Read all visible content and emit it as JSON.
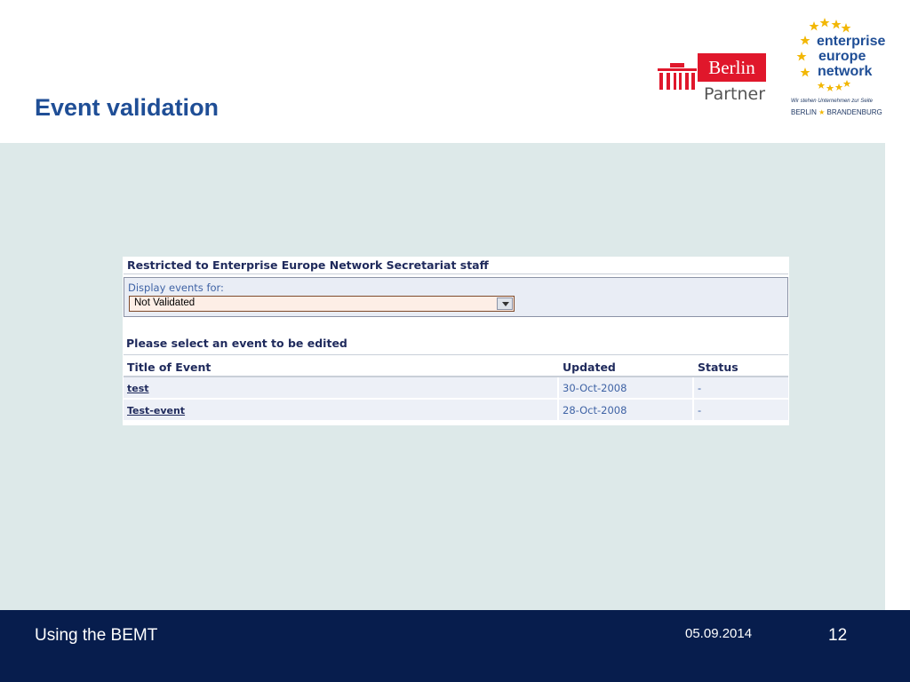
{
  "slide": {
    "title": "Event validation"
  },
  "logos": {
    "berlin_partner": {
      "box_text": "Berlin",
      "sub_text": "Partner",
      "color": "#e0172b"
    },
    "een": {
      "word1": "enterprise",
      "word2": "europe",
      "word3": "network",
      "tagline": "Wir stehen Unternehmen zur Seite",
      "region_left": "BERLIN",
      "region_right": "BRANDENBURG",
      "star_color": "#f2b705"
    }
  },
  "panel": {
    "restricted_heading": "Restricted to Enterprise Europe Network Secretariat staff",
    "filter_label": "Display events for:",
    "filter_selected": "Not Validated",
    "select_heading": "Please select an event to be edited",
    "columns": [
      "Title of Event",
      "Updated",
      "Status"
    ],
    "rows": [
      {
        "title": "test",
        "updated": "30-Oct-2008",
        "status": "-"
      },
      {
        "title": "Test-event",
        "updated": "28-Oct-2008",
        "status": "-"
      }
    ]
  },
  "footer": {
    "left": "Using the BEMT",
    "date": "05.09.2014",
    "page": "12"
  },
  "colors": {
    "title_blue": "#1f4e96",
    "footer_navy": "#071d4d",
    "content_bg": "#dde9e9"
  }
}
